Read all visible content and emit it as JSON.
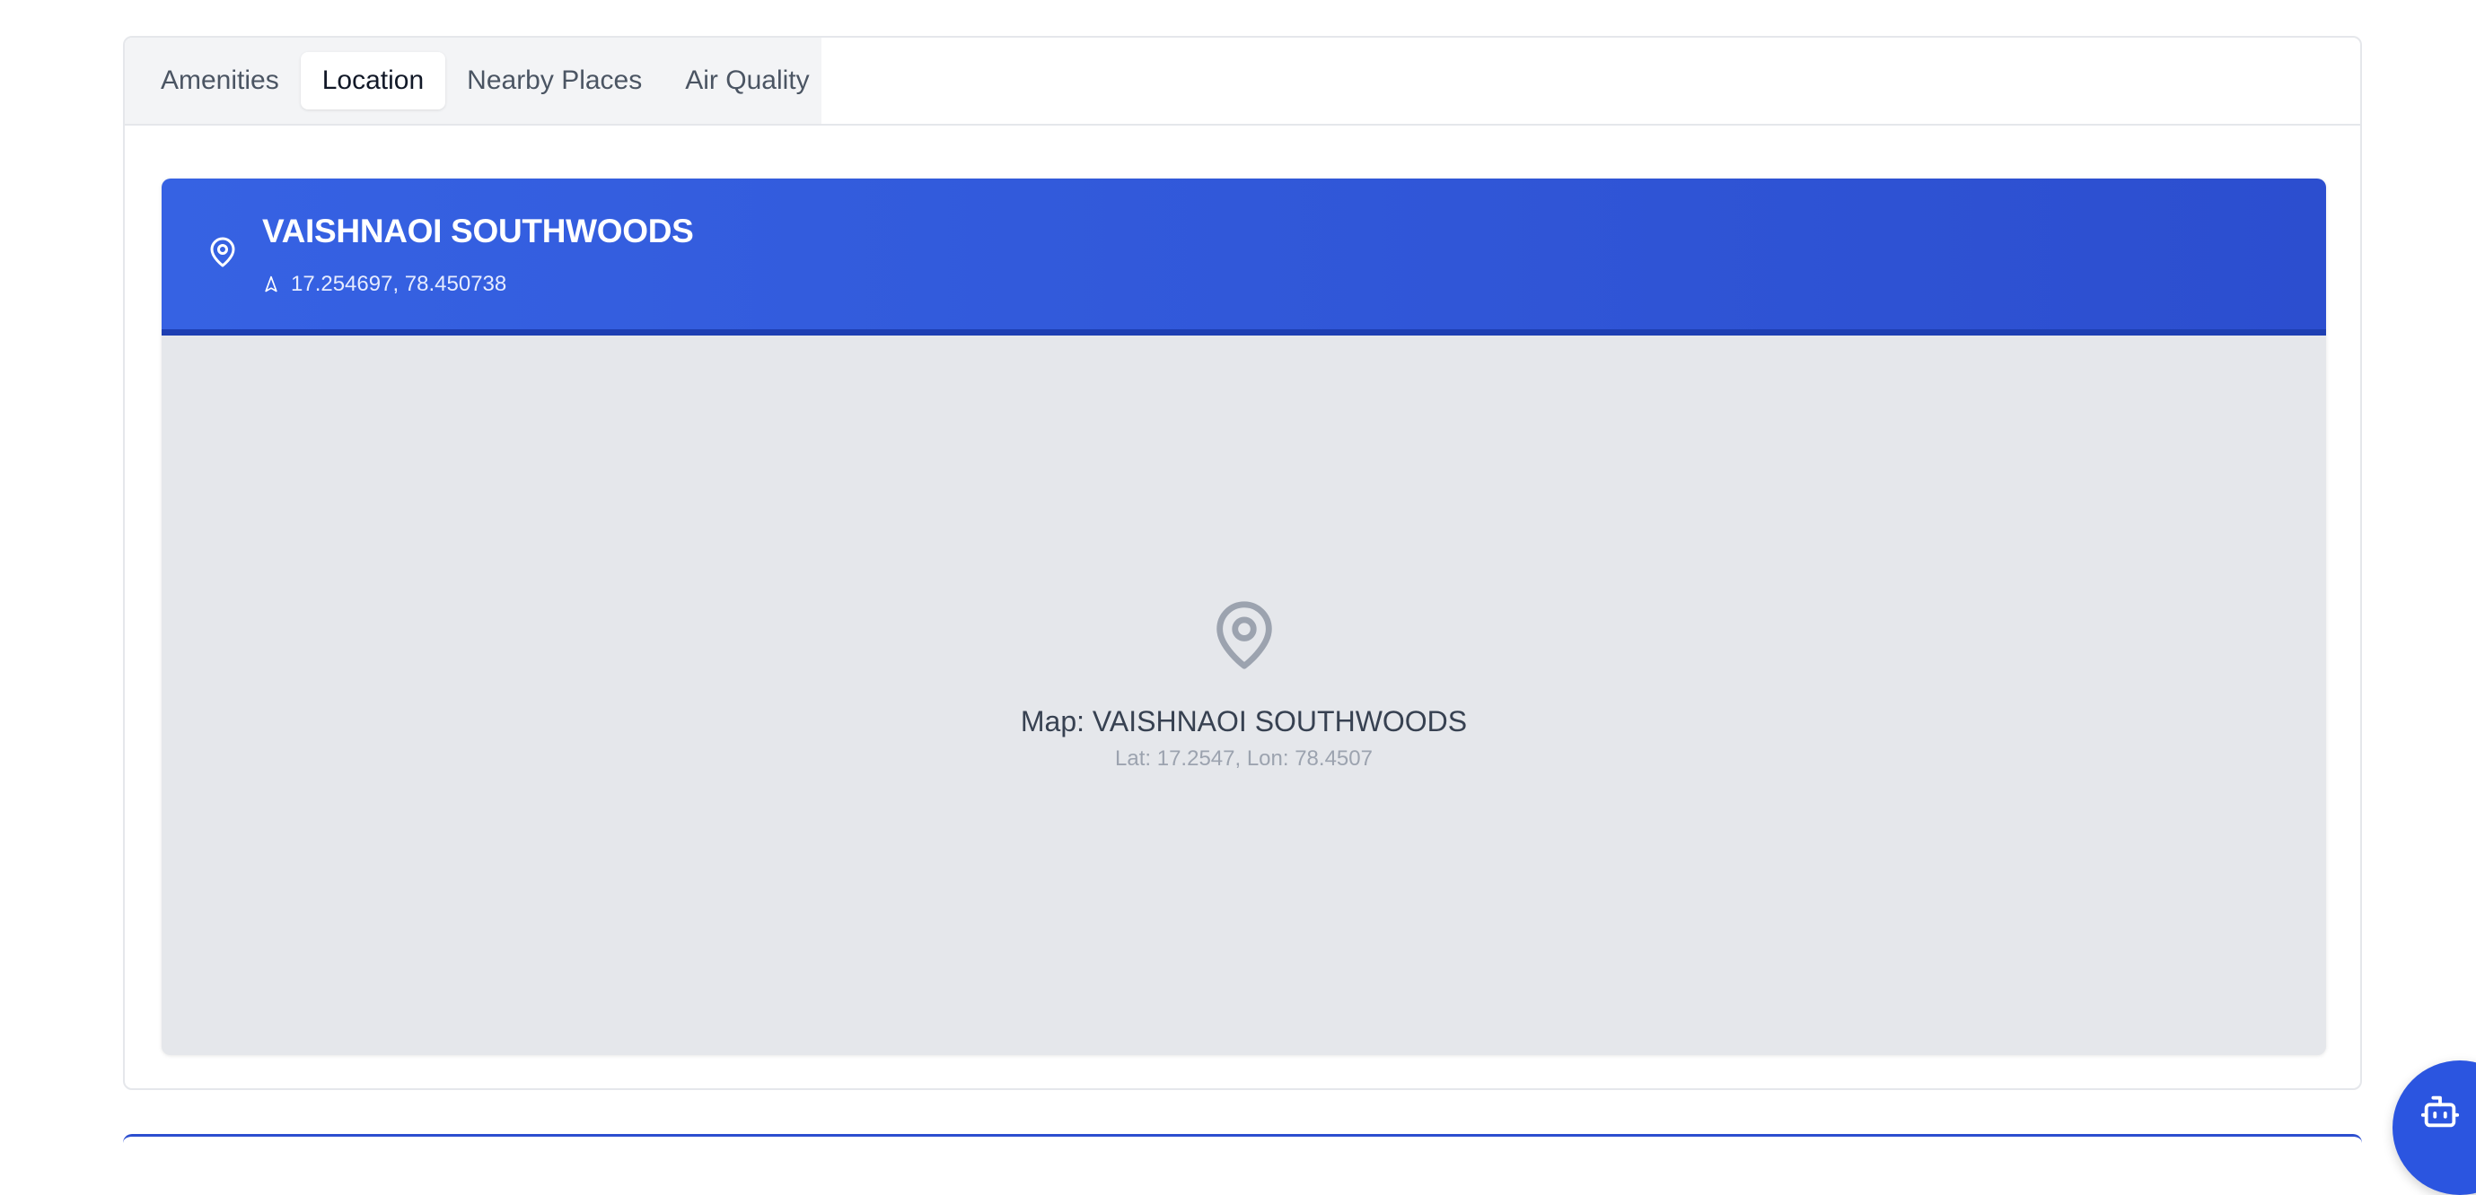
{
  "tabs": [
    {
      "label": "Amenities"
    },
    {
      "label": "Location"
    },
    {
      "label": "Nearby Places"
    },
    {
      "label": "Air Quality"
    }
  ],
  "active_tab": "Location",
  "location": {
    "title": "VAISHNAOI SOUTHWOODS",
    "coordinates": "17.254697, 78.450738"
  },
  "map": {
    "label": "Map: VAISHNAOI SOUTHWOODS",
    "sub": "Lat: 17.2547, Lon: 78.4507"
  },
  "icons": {
    "header_pin": "map-pin-icon",
    "coordinates": "navigation-icon",
    "map_marker": "map-pin-icon",
    "assistant": "bot-icon"
  },
  "colors": {
    "header_gradient_start": "#3662e3",
    "header_gradient_end": "#2c4ecf",
    "map_background": "#e5e7eb",
    "active_tab_bg": "#ffffff",
    "tablist_bg": "#f3f4f6",
    "fab": "#2b55e0"
  }
}
